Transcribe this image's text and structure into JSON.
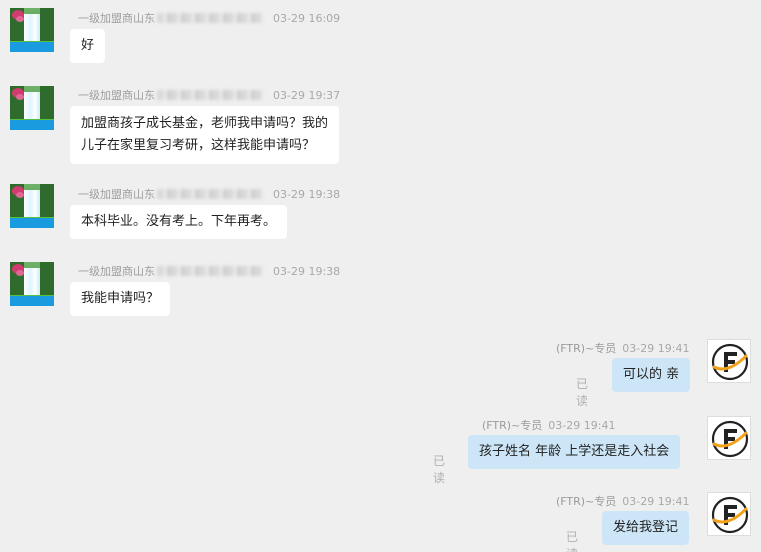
{
  "messages": [
    {
      "side": "left",
      "sender": "一级加盟商山东",
      "time": "03-29 16:09",
      "lines": [
        "好"
      ]
    },
    {
      "side": "left",
      "sender": "一级加盟商山东",
      "time": "03-29 19:37",
      "lines": [
        "加盟商孩子成长基金，老师我申请吗？我的",
        "儿子在家里复习考研，这样我能申请吗？"
      ]
    },
    {
      "side": "left",
      "sender": "一级加盟商山东",
      "time": "03-29 19:38",
      "lines": [
        "本科毕业。没有考上。下年再考。"
      ]
    },
    {
      "side": "left",
      "sender": "一级加盟商山东",
      "time": "03-29 19:38",
      "lines": [
        "我能申请吗？"
      ]
    },
    {
      "side": "right",
      "sender": "(FTR)~专员",
      "time": "03-29 19:41",
      "lines": [
        "可以的 亲"
      ],
      "status": "已读"
    },
    {
      "side": "right",
      "sender": "(FTR)~专员",
      "time": "03-29 19:41",
      "lines": [
        "孩子姓名 年龄 上学还是走入社会"
      ],
      "status": "已读"
    },
    {
      "side": "right",
      "sender": "(FTR)~专员",
      "time": "03-29 19:41",
      "lines": [
        "发给我登记"
      ],
      "status": "已读"
    }
  ],
  "avatars": {
    "left": "waterfall-avatar",
    "right": "ftr-logo-avatar"
  },
  "colors": {
    "background": "#efefef",
    "left_bubble": "#ffffff",
    "right_bubble": "#cde6f7",
    "meta_text": "#9e9e9e"
  }
}
